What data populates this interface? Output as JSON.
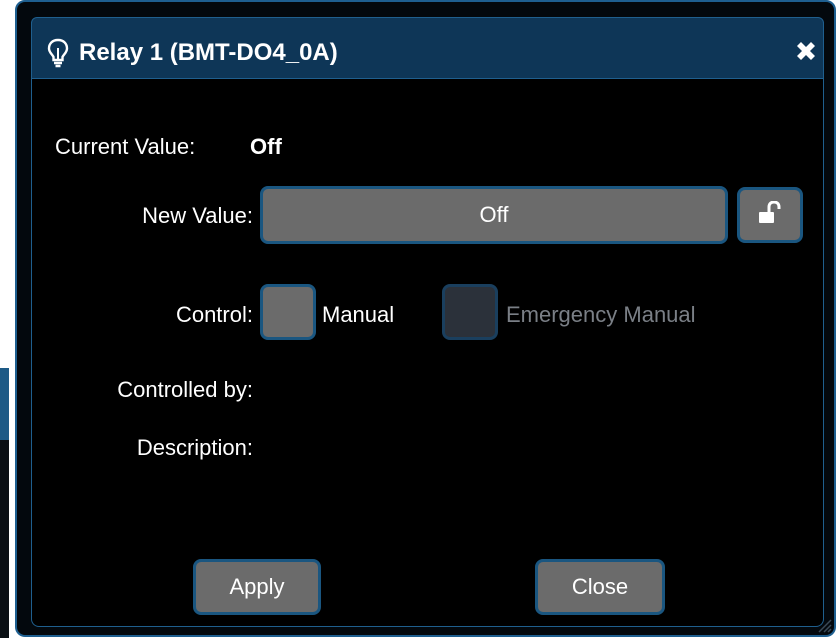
{
  "dialog": {
    "title": "Relay 1 (BMT-DO4_0A)",
    "title_icon": "lightbulb-icon",
    "close_icon": "close-icon"
  },
  "fields": {
    "current_value_label": "Current Value:",
    "current_value": "Off",
    "new_value_label": "New Value:",
    "new_value": "Off",
    "lock_icon": "unlock-icon",
    "control_label": "Control:",
    "manual_label": "Manual",
    "emergency_manual_label": "Emergency Manual",
    "controlled_by_label": "Controlled by:",
    "controlled_by_value": "",
    "description_label": "Description:",
    "description_value": ""
  },
  "buttons": {
    "apply": "Apply",
    "close": "Close"
  },
  "colors": {
    "dialog_bg": "#03080d",
    "titlebar_bg": "#0e3657",
    "border_blue": "#1e5f90",
    "button_gray": "#6b6b6b",
    "disabled_text": "#7a7f86"
  }
}
